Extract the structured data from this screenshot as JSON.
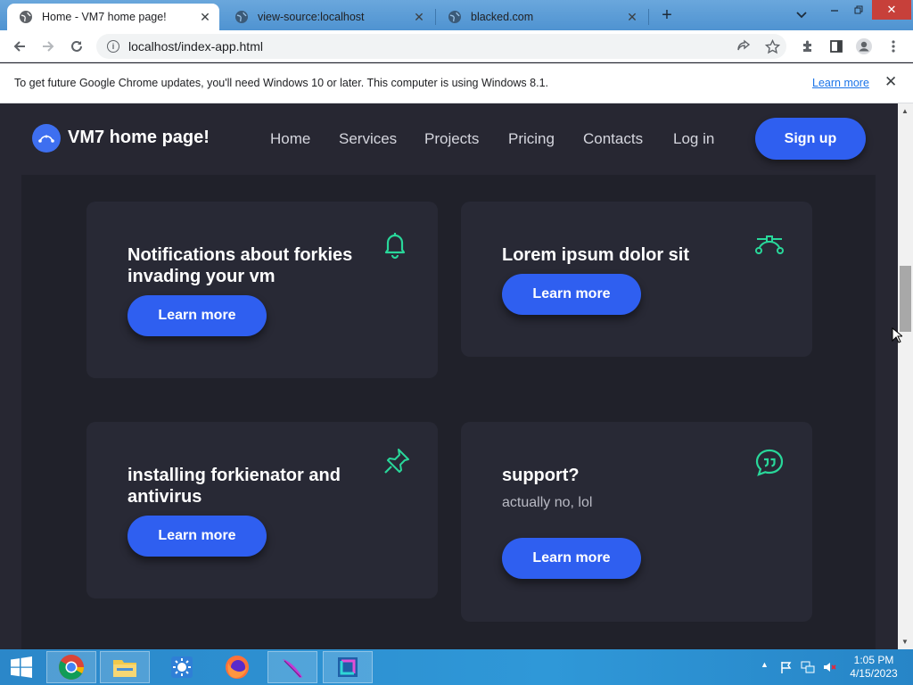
{
  "browser": {
    "tabs": [
      {
        "title": "Home - VM7 home page!",
        "active": true
      },
      {
        "title": "view-source:localhost",
        "active": false
      },
      {
        "title": "blacked.com",
        "active": false
      }
    ],
    "new_tab_symbol": "+",
    "url": "localhost/index-app.html",
    "infobar": {
      "message": "To get future Google Chrome updates, you'll need Windows 10 or later. This computer is using Windows 8.1.",
      "link": "Learn more"
    }
  },
  "site": {
    "brand": "VM7 home page!",
    "nav": [
      "Home",
      "Services",
      "Projects",
      "Pricing",
      "Contacts",
      "Log in"
    ],
    "signup": "Sign up",
    "accent": "#2f5ff0",
    "icon_color": "#29d79a",
    "cards": [
      {
        "title_lines": [
          "Notifications about forkies",
          "invading your vm"
        ],
        "subtitle": "",
        "button": "Learn more",
        "icon": "bell-icon"
      },
      {
        "title_lines": [
          "Lorem ipsum dolor sit"
        ],
        "subtitle": "",
        "button": "Learn more",
        "icon": "bezier-curve-icon"
      },
      {
        "title_lines": [
          "installing forkienator and",
          "antivirus"
        ],
        "subtitle": "",
        "button": "Learn more",
        "icon": "pin-icon"
      },
      {
        "title_lines": [
          "support?"
        ],
        "subtitle": "actually no, lol",
        "button": "Learn more",
        "icon": "chat-quote-icon"
      }
    ]
  },
  "taskbar": {
    "time": "1:05 PM",
    "date": "4/15/2023",
    "apps": [
      "chrome-icon",
      "file-explorer-icon",
      "weather-icon",
      "firefox-icon",
      "feather-app-icon",
      "square-app-icon"
    ]
  }
}
